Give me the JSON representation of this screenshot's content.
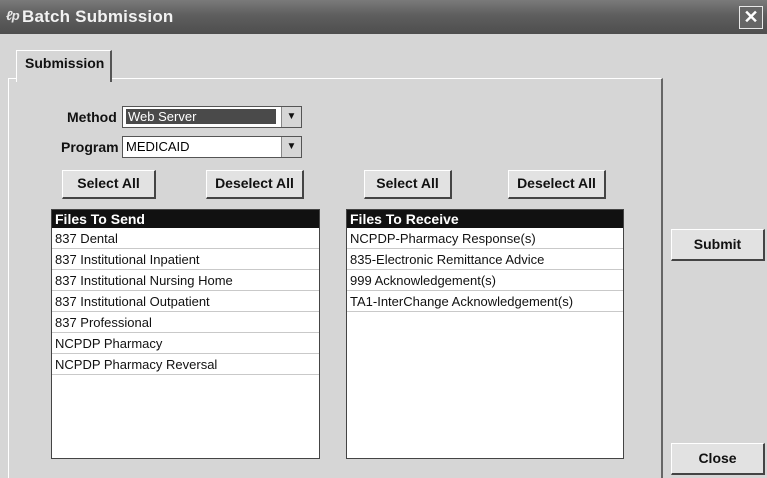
{
  "window": {
    "title": "Batch Submission",
    "close_glyph": "✕"
  },
  "tabs": [
    {
      "label": "Submission"
    }
  ],
  "form": {
    "method_label": "Method",
    "method_value": "Web Server",
    "program_label": "Program",
    "program_value": "MEDICAID"
  },
  "send_panel": {
    "select_all_label": "Select All",
    "deselect_all_label": "Deselect All",
    "header": "Files To Send",
    "items": [
      "837 Dental",
      "837 Institutional Inpatient",
      "837 Institutional Nursing Home",
      "837 Institutional Outpatient",
      "837 Professional",
      "NCPDP Pharmacy",
      "NCPDP Pharmacy Reversal"
    ]
  },
  "receive_panel": {
    "select_all_label": "Select All",
    "deselect_all_label": "Deselect All",
    "header": "Files To Receive",
    "items": [
      "NCPDP-Pharmacy Response(s)",
      "835-Electronic Remittance Advice",
      "999 Acknowledgement(s)",
      "TA1-InterChange Acknowledgement(s)"
    ]
  },
  "actions": {
    "submit_label": "Submit",
    "close_label": "Close"
  },
  "icons": {
    "app": "app-logo-icon",
    "close": "close-icon",
    "dropdown": "chevron-down-icon"
  }
}
